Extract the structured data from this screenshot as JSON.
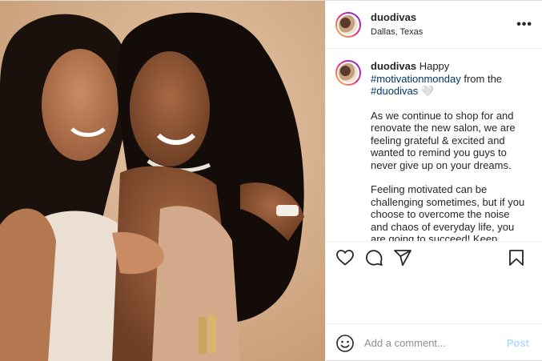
{
  "header": {
    "username": "duodivas",
    "location": "Dallas, Texas",
    "more_glyph": "•••"
  },
  "caption": {
    "username": "duodivas",
    "line_intro": "Happy ",
    "tag1": "#motivationmonday",
    "line_from": " from the ",
    "tag2": "#duodivas",
    "heart1": " 🤍",
    "paragraph2": "As we continue to shop for and renovate the new salon, we are feeling grateful & excited and wanted to remind you guys to never give up on your dreams.",
    "paragraph3": "Feeling motivated can be challenging sometimes, but if you choose to overcome the noise and chaos of everyday life, you are going to succeed! Keep grinding, the hard work will pay off sooner than you think",
    "heart2": " 💗"
  },
  "actions": {
    "icons": [
      "heart-icon",
      "comment-icon",
      "share-icon",
      "bookmark-icon"
    ]
  },
  "comment_box": {
    "placeholder": "Add a comment...",
    "post_label": "Post"
  },
  "colors": {
    "link": "#00376b",
    "post_disabled": "#b3dbff",
    "border": "#efefef"
  }
}
